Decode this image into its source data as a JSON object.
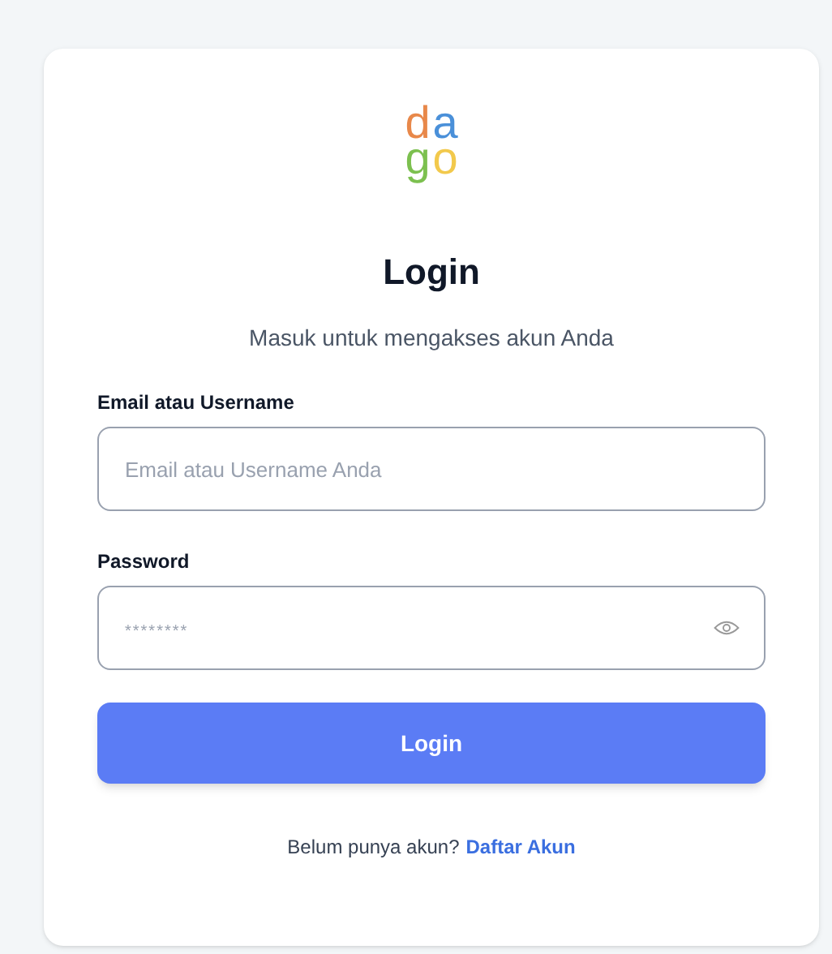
{
  "logo": {
    "letters": [
      {
        "char": "d",
        "color": "#e8884a"
      },
      {
        "char": "a",
        "color": "#4a90d9"
      },
      {
        "char": "g",
        "color": "#7cc04f"
      },
      {
        "char": "o",
        "color": "#f2c94c"
      }
    ]
  },
  "title": "Login",
  "subtitle": "Masuk untuk mengakses akun Anda",
  "fields": [
    {
      "label": "Email atau Username",
      "placeholder": "Email atau Username Anda",
      "kind": "text"
    },
    {
      "label": "Password",
      "placeholder": "********",
      "kind": "password"
    }
  ],
  "button": "Login",
  "footer": {
    "text": "Belum punya akun?",
    "link": "Daftar Akun"
  }
}
